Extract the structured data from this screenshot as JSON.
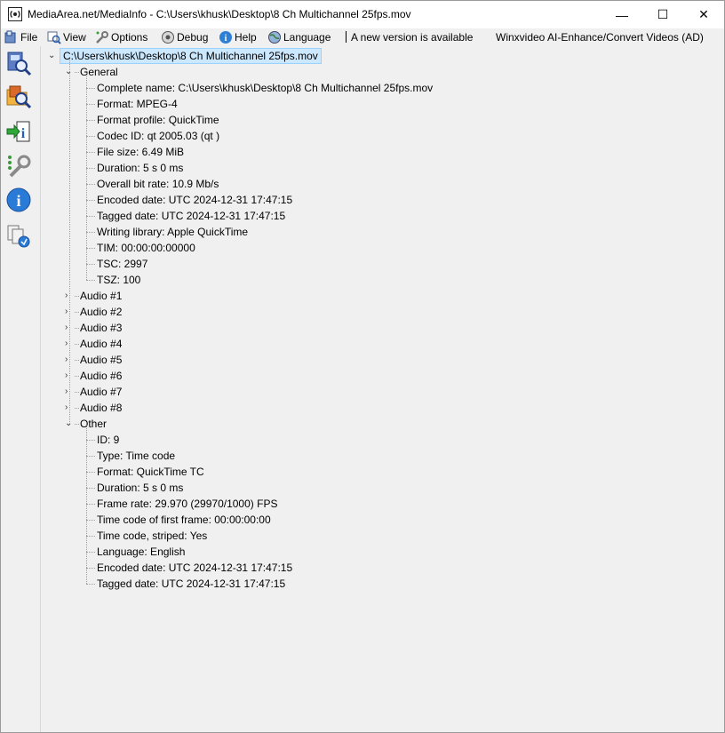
{
  "window": {
    "title": "MediaArea.net/MediaInfo - C:\\Users\\khusk\\Desktop\\8 Ch Multichannel 25fps.mov",
    "minimize": "—",
    "maximize": "☐",
    "close": "✕"
  },
  "menu": {
    "file": "File",
    "view": "View",
    "options": "Options",
    "debug": "Debug",
    "help": "Help",
    "language": "Language",
    "new_version": "A new version is available",
    "ad": "Winxvideo AI-Enhance/Convert Videos (AD)"
  },
  "toolbar": {
    "icons": [
      "open-file-icon",
      "open-folder-icon",
      "export-icon",
      "preferences-icon",
      "about-icon",
      "knowledge-icon"
    ]
  },
  "tree": {
    "root": "C:\\Users\\khusk\\Desktop\\8 Ch Multichannel 25fps.mov",
    "general": {
      "label": "General",
      "items": [
        "Complete name: C:\\Users\\khusk\\Desktop\\8 Ch Multichannel 25fps.mov",
        "Format: MPEG-4",
        "Format profile: QuickTime",
        "Codec ID: qt   2005.03 (qt  )",
        "File size: 6.49 MiB",
        "Duration: 5 s 0 ms",
        "Overall bit rate: 10.9 Mb/s",
        "Encoded date: UTC 2024-12-31 17:47:15",
        "Tagged date: UTC 2024-12-31 17:47:15",
        "Writing library: Apple QuickTime",
        "TIM: 00:00:00:00000",
        "TSC: 2997",
        "TSZ: 100"
      ]
    },
    "audio": [
      "Audio #1",
      "Audio #2",
      "Audio #3",
      "Audio #4",
      "Audio #5",
      "Audio #6",
      "Audio #7",
      "Audio #8"
    ],
    "other": {
      "label": "Other",
      "items": [
        "ID: 9",
        "Type: Time code",
        "Format: QuickTime TC",
        "Duration: 5 s 0 ms",
        "Frame rate: 29.970 (29970/1000) FPS",
        "Time code of first frame: 00:00:00:00",
        "Time code, striped: Yes",
        "Language: English",
        "Encoded date: UTC 2024-12-31 17:47:15",
        "Tagged date: UTC 2024-12-31 17:47:15"
      ]
    }
  },
  "colors": {
    "selection_bg": "#cce8ff",
    "selection_border": "#99d1ff",
    "window_bg": "#f0f0f0"
  }
}
